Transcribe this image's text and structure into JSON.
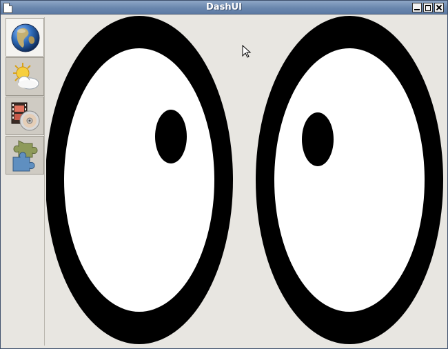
{
  "window": {
    "title": "DashUI",
    "controls": [
      "minimize",
      "maximize",
      "close"
    ]
  },
  "sidebar": {
    "items": [
      {
        "name": "globe",
        "icon": "globe-icon",
        "active": true
      },
      {
        "name": "weather",
        "icon": "weather-icon",
        "active": false
      },
      {
        "name": "media",
        "icon": "film-disc-icon",
        "active": false
      },
      {
        "name": "puzzle",
        "icon": "puzzle-icon",
        "active": false
      }
    ]
  },
  "eyes": {
    "outline_color": "#000000",
    "sclera_color": "#ffffff",
    "pupil_color": "#000000"
  }
}
